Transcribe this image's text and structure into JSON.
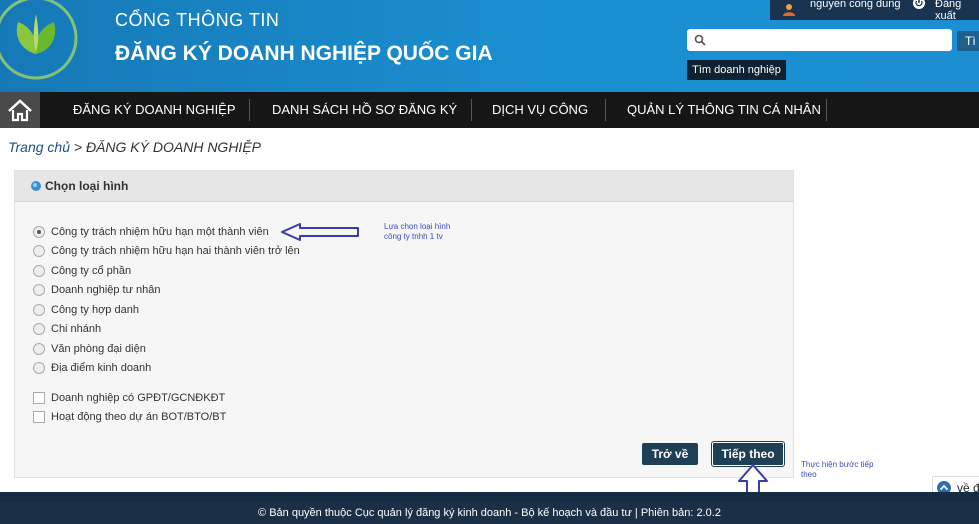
{
  "header": {
    "title_line1": "CỔNG THÔNG TIN",
    "title_line2": "ĐĂNG KÝ DOANH NGHIỆP QUỐC GIA",
    "user_name": "nguyen cong dung",
    "logout_label": "Đăng xuất",
    "search_placeholder": "",
    "search_button": "Tì",
    "search_tooltip": "Tìm doanh nghiệp"
  },
  "nav": {
    "items": [
      {
        "label": "ĐĂNG KÝ DOANH NGHIỆP"
      },
      {
        "label": "DANH SÁCH HỒ SƠ ĐĂNG KÝ"
      },
      {
        "label": "DỊCH VỤ CÔNG"
      },
      {
        "label": "QUẢN LÝ THÔNG TIN CÁ NHÂN"
      }
    ]
  },
  "breadcrumb": {
    "home": "Trang chủ",
    "separator": ">",
    "current": "ĐĂNG KÝ DOANH NGHIỆP"
  },
  "panel": {
    "title": "Chọn loại hình",
    "options": [
      {
        "label": "Công ty trách nhiệm hữu hạn một thành viên",
        "checked": true
      },
      {
        "label": "Công ty trách nhiệm hữu hạn hai thành viên trở lên",
        "checked": false
      },
      {
        "label": "Công ty cổ phần",
        "checked": false
      },
      {
        "label": "Doanh nghiệp tư nhân",
        "checked": false
      },
      {
        "label": "Công ty hợp danh",
        "checked": false
      },
      {
        "label": "Chi nhánh",
        "checked": false
      },
      {
        "label": "Văn phòng đại diện",
        "checked": false
      },
      {
        "label": "Địa điểm kinh doanh",
        "checked": false
      }
    ],
    "checkboxes": [
      {
        "label": "Doanh nghiệp có GPĐT/GCNĐKĐT",
        "checked": false
      },
      {
        "label": "Hoạt động theo dự án BOT/BTO/BT",
        "checked": false
      }
    ],
    "back_button": "Trở về",
    "next_button": "Tiếp theo"
  },
  "annotations": {
    "select_type_line1": "Lựa chọn loại hình",
    "select_type_line2": "công ty tnhh 1 tv",
    "next_step_line1": "Thực hiện bước tiếp",
    "next_step_line2": "theo"
  },
  "footer": {
    "text": "© Bản quyền thuộc Cục quản lý đăng ký kinh doanh - Bộ kế hoạch và đầu tư | Phiên bản: 2.0.2",
    "back_to_top": "về đ"
  },
  "colors": {
    "header_blue": "#1a8fd0",
    "nav_dark": "#161616",
    "button_dark": "#1f3f55",
    "annotation_blue": "#3a4cc0"
  }
}
